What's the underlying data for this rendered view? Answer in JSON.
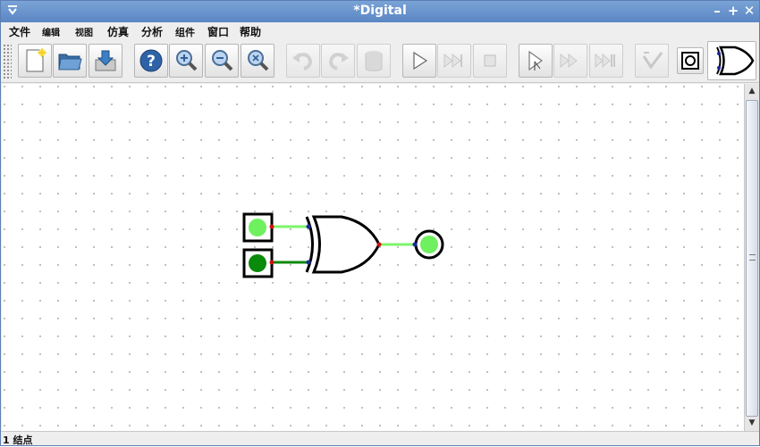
{
  "window": {
    "title": "*Digital"
  },
  "titlebar_buttons": {
    "minimize": "–",
    "maximize": "+",
    "close": "✕"
  },
  "menu": [
    {
      "id": "file",
      "label": "文件"
    },
    {
      "id": "edit",
      "label": "编辑"
    },
    {
      "id": "view",
      "label": "视图"
    },
    {
      "id": "simulate",
      "label": "仿真"
    },
    {
      "id": "analyze",
      "label": "分析"
    },
    {
      "id": "components",
      "label": "组件"
    },
    {
      "id": "window",
      "label": "窗口"
    },
    {
      "id": "help",
      "label": "帮助"
    }
  ],
  "toolbar": {
    "buttons": [
      {
        "id": "new",
        "icon": "new-file-icon",
        "enabled": true
      },
      {
        "id": "open",
        "icon": "open-folder-icon",
        "enabled": true
      },
      {
        "id": "save",
        "icon": "save-icon",
        "enabled": true
      },
      {
        "id": "help",
        "icon": "help-icon",
        "enabled": true
      },
      {
        "id": "zoom-in",
        "icon": "zoom-in-icon",
        "enabled": true
      },
      {
        "id": "zoom-out",
        "icon": "zoom-out-icon",
        "enabled": true
      },
      {
        "id": "zoom-fit",
        "icon": "zoom-fit-icon",
        "enabled": true
      },
      {
        "id": "undo",
        "icon": "undo-icon",
        "enabled": false
      },
      {
        "id": "redo",
        "icon": "redo-icon",
        "enabled": false
      },
      {
        "id": "delete",
        "icon": "delete-icon",
        "enabled": false
      },
      {
        "id": "run",
        "icon": "play-icon",
        "enabled": true
      },
      {
        "id": "step",
        "icon": "fast-forward-icon",
        "enabled": false
      },
      {
        "id": "stop",
        "icon": "stop-icon",
        "enabled": false
      },
      {
        "id": "micro-step",
        "icon": "micro-step-icon",
        "enabled": true
      },
      {
        "id": "run-to-break",
        "icon": "run-to-break-icon",
        "enabled": false
      },
      {
        "id": "step-to-end",
        "icon": "step-to-end-icon",
        "enabled": false
      },
      {
        "id": "analyze",
        "icon": "analyze-icon",
        "enabled": false
      },
      {
        "id": "element-state",
        "icon": "element-state-icon",
        "enabled": true
      },
      {
        "id": "last-component",
        "icon": "xor-gate-icon",
        "enabled": true
      }
    ]
  },
  "circuit": {
    "inputs": [
      {
        "name": "input-a",
        "state": "high"
      },
      {
        "name": "input-b",
        "state": "low"
      }
    ],
    "gate": "XOR",
    "output": {
      "name": "output-led",
      "state": "high"
    }
  },
  "colors": {
    "wire_high": "#7df56a",
    "wire_low": "#0a8a0a",
    "led_on": "#6ef05f",
    "led_off": "#0a8a0a",
    "pin_red": "#d01010",
    "pin_blue": "#1a2aa0"
  },
  "status": {
    "text": "1 结点"
  }
}
